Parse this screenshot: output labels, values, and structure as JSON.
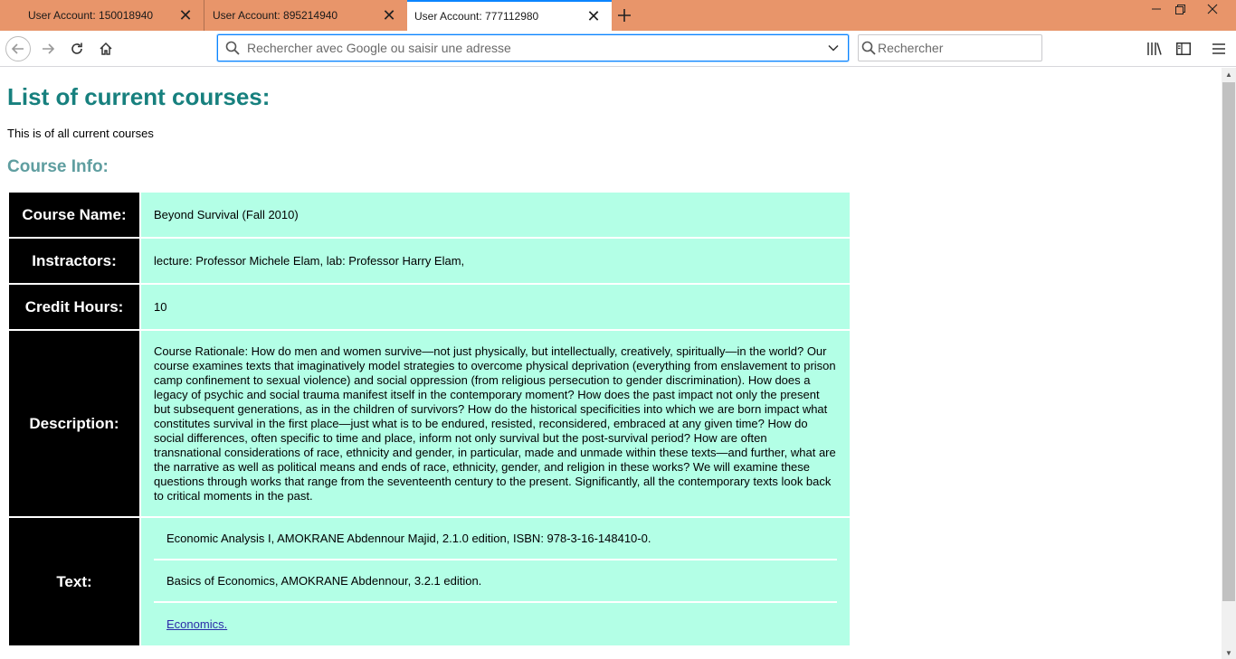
{
  "browser": {
    "tabs": [
      {
        "title": "User Account: 150018940",
        "active": false
      },
      {
        "title": "User Account: 895214940",
        "active": false
      },
      {
        "title": "User Account: 777112980",
        "active": true
      }
    ],
    "url_placeholder": "Rechercher avec Google ou saisir une adresse",
    "search_placeholder": "Rechercher",
    "accent_color": "#0a84ff",
    "tabstrip_color": "#e8956a"
  },
  "page": {
    "title": "List of current courses:",
    "intro": "This is of all current courses",
    "section_title": "Course Info:",
    "title_color": "#17807e",
    "section_color": "#5f9ea0",
    "cell_color": "#b3ffe6"
  },
  "course": {
    "name_label": "Course Name:",
    "name": "Beyond Survival (Fall 2010)",
    "instructors_label": "Instractors:",
    "instructors": "lecture: Professor Michele Elam, lab: Professor Harry Elam,",
    "credit_label": "Credit Hours:",
    "credit_hours": "10",
    "description_label": "Description:",
    "description": "Course Rationale: How do men and women survive—not just physically, but intellectually, creatively, spiritually—in the world? Our course examines texts that imaginatively model strategies to overcome physical deprivation (everything from enslavement to prison camp confinement to sexual violence) and social oppression (from religious persecution to gender discrimination). How does a legacy of psychic and social trauma manifest itself in the contemporary moment? How does the past impact not only the present but subsequent generations, as in the children of survivors? How do the historical specificities into which we are born impact what constitutes survival in the first place—just what is to be endured, resisted, reconsidered, embraced at any given time? How do social differences, often specific to time and place, inform not only survival but the post-survival period? How are often transnational considerations of race, ethnicity and gender, in particular, made and unmade within these texts—and further, what are the narrative as well as political means and ends of race, ethnicity, gender, and religion in these works? We will examine these questions through works that range from the seventeenth century to the present. Significantly, all the contemporary texts look back to critical moments in the past.",
    "text_label": "Text:",
    "texts": [
      "Economic Analysis I,  AMOKRANE  Abdennour  Majid,  2.1.0 edition, ISBN: 978-3-16-148410-0.",
      "Basics of Economics,  AMOKRANE  Abdennour,  3.2.1 edition."
    ],
    "text_link": "Economics."
  }
}
